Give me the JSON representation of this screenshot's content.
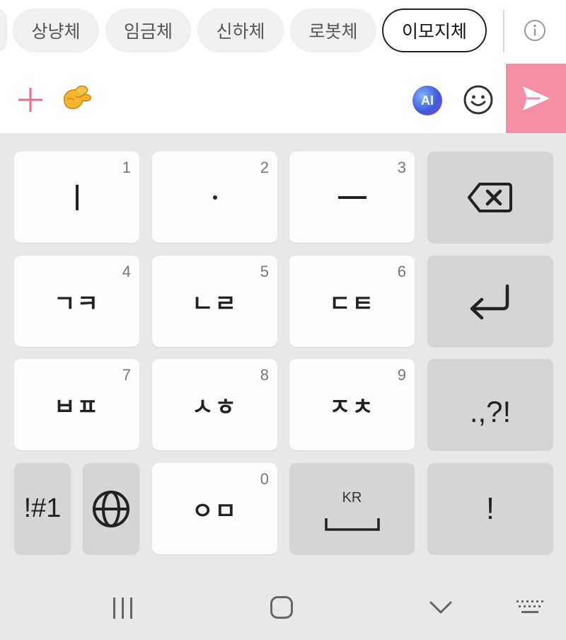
{
  "chips": [
    {
      "label": "상냥체",
      "selected": false
    },
    {
      "label": "임금체",
      "selected": false
    },
    {
      "label": "신하체",
      "selected": false
    },
    {
      "label": "로봇체",
      "selected": false
    },
    {
      "label": "이모지체",
      "selected": true
    }
  ],
  "toolbar": {
    "ai_label": "AI"
  },
  "colors": {
    "send_bg": "#f48ea5",
    "plus": "#e46e8a",
    "selected_chip_border": "#222222"
  },
  "icons": {
    "info": "info-icon",
    "plus": "plus-icon",
    "emoji": "pinching-hand-emoji-icon",
    "ai": "ai-icon",
    "smile": "smile-icon",
    "send": "send-icon",
    "backspace": "backspace-icon",
    "enter": "enter-icon",
    "globe": "globe-icon",
    "space": "space-icon"
  },
  "keys": {
    "k1": {
      "label": "ㅣ",
      "num": "1"
    },
    "k2": {
      "label": "·",
      "num": "2"
    },
    "k3": {
      "label": "ㅡ",
      "num": "3"
    },
    "k4": {
      "label": "ㄱㅋ",
      "num": "4"
    },
    "k5": {
      "label": "ㄴㄹ",
      "num": "5"
    },
    "k6": {
      "label": "ㄷㅌ",
      "num": "6"
    },
    "k7": {
      "label": "ㅂㅍ",
      "num": "7"
    },
    "k8": {
      "label": "ㅅㅎ",
      "num": "8"
    },
    "k9": {
      "label": "ㅈㅊ",
      "num": "9"
    },
    "k0": {
      "label": "ㅇㅁ",
      "num": "0"
    },
    "punct": ".,?!",
    "symbols": "!#1",
    "space_lang": "KR",
    "exclaim": "!"
  }
}
